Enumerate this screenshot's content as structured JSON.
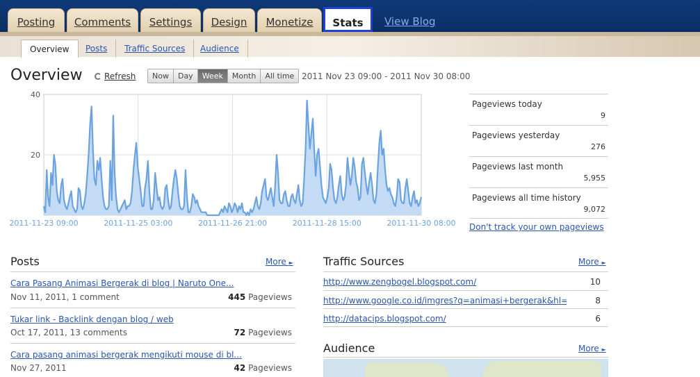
{
  "nav": {
    "tabs": [
      "Posting",
      "Comments",
      "Settings",
      "Design",
      "Monetize",
      "Stats"
    ],
    "active_tab": "Stats",
    "view_blog": "View Blog"
  },
  "subnav": {
    "items": [
      "Overview",
      "Posts",
      "Traffic Sources",
      "Audience"
    ],
    "active": "Overview"
  },
  "overview": {
    "title": "Overview",
    "refresh": "Refresh",
    "range_buttons": [
      "Now",
      "Day",
      "Week",
      "Month",
      "All time"
    ],
    "active_range": "Week",
    "date_range": "2011 Nov 23 09:00 - 2011 Nov 30 08:00"
  },
  "chart_data": {
    "type": "area",
    "y_ticks": [
      "40",
      "20"
    ],
    "ylim": [
      0,
      40
    ],
    "x_tick_labels": [
      "2011-11-23 09:00",
      "2011-11-25 03:00",
      "2011-11-26 21:00",
      "2011-11-28 15:00",
      "2011-11-30 08:00"
    ],
    "values": [
      3,
      1,
      15,
      6,
      3,
      14,
      10,
      20,
      17,
      8,
      5,
      4,
      10,
      12,
      5,
      3,
      2,
      4,
      6,
      8,
      3,
      2,
      1,
      2,
      9,
      8,
      3,
      2,
      4,
      7,
      13,
      20,
      30,
      36,
      22,
      12,
      10,
      18,
      15,
      19,
      12,
      6,
      3,
      2,
      2,
      3,
      18,
      5,
      33,
      14,
      6,
      2,
      1,
      2,
      3,
      4,
      5,
      2,
      3,
      3,
      4,
      8,
      15,
      20,
      24,
      16,
      12,
      8,
      3,
      3,
      9,
      12,
      18,
      8,
      2,
      2,
      5,
      14,
      9,
      5,
      6,
      3,
      2,
      3,
      9,
      10,
      5,
      2,
      3,
      8,
      12,
      15,
      12,
      7,
      3,
      2,
      2,
      3,
      15,
      6,
      1,
      1,
      3,
      7,
      6,
      4,
      5,
      3,
      2,
      1,
      1,
      1,
      1,
      0,
      0,
      0,
      0,
      0,
      0,
      0,
      0,
      0,
      1,
      2,
      1,
      3,
      2,
      1,
      4,
      3,
      1,
      2,
      4,
      3,
      1,
      3,
      2,
      4,
      1,
      1,
      0,
      1,
      0,
      2,
      1,
      2,
      4,
      6,
      3,
      2,
      4,
      8,
      10,
      12,
      6,
      5,
      7,
      9,
      6,
      3,
      10,
      20,
      14,
      5,
      4,
      4,
      7,
      8,
      5,
      3,
      3,
      6,
      7,
      5,
      4,
      7,
      10,
      5,
      3,
      4,
      12,
      22,
      38,
      30,
      22,
      27,
      32,
      22,
      13,
      20,
      22,
      16,
      10,
      6,
      5,
      4,
      6,
      9,
      17,
      15,
      9,
      5,
      4,
      6,
      10,
      13,
      7,
      5,
      6,
      10,
      19,
      14,
      10,
      13,
      19,
      16,
      11,
      9,
      5,
      6,
      17,
      19,
      14,
      10,
      7,
      11,
      14,
      10,
      5,
      4,
      7,
      16,
      24,
      28,
      20,
      22,
      15,
      10,
      8,
      9,
      7,
      6,
      4,
      3,
      6,
      12,
      11,
      5,
      4,
      4,
      9,
      12,
      8,
      4,
      3,
      6,
      8,
      4,
      5,
      3,
      4,
      6
    ]
  },
  "stats": [
    {
      "label": "Pageviews today",
      "value": "9"
    },
    {
      "label": "Pageviews yesterday",
      "value": "276"
    },
    {
      "label": "Pageviews last month",
      "value": "5,955"
    },
    {
      "label": "Pageviews all time history",
      "value": "9,072"
    }
  ],
  "dont_track": "Don't track your own pageviews",
  "posts": {
    "title": "Posts",
    "more": "More",
    "items": [
      {
        "title": "Cara Pasang Animasi Bergerak di blog | Naruto One...",
        "meta": "Nov 11, 2011, 1 comment",
        "count": "445",
        "unit": "Pageviews"
      },
      {
        "title": "Tukar link - Backlink dengan blog / web",
        "meta": "Oct 17, 2011, 13 comments",
        "count": "72",
        "unit": "Pageviews"
      },
      {
        "title": "Cara pasang animasi bergerak mengikuti mouse di bl...",
        "meta": "Nov 27, 2011",
        "count": "42",
        "unit": "Pageviews"
      }
    ]
  },
  "traffic": {
    "title": "Traffic Sources",
    "more": "More",
    "items": [
      {
        "url": "http://www.zengbogel.blogspot.com/",
        "count": "10"
      },
      {
        "url": "http://www.google.co.id/imgres?q=animasi+bergerak&hl=jw",
        "count": "8"
      },
      {
        "url": "http://datacips.blogspot.com/",
        "count": "6"
      }
    ]
  },
  "audience": {
    "title": "Audience",
    "more": "More"
  }
}
